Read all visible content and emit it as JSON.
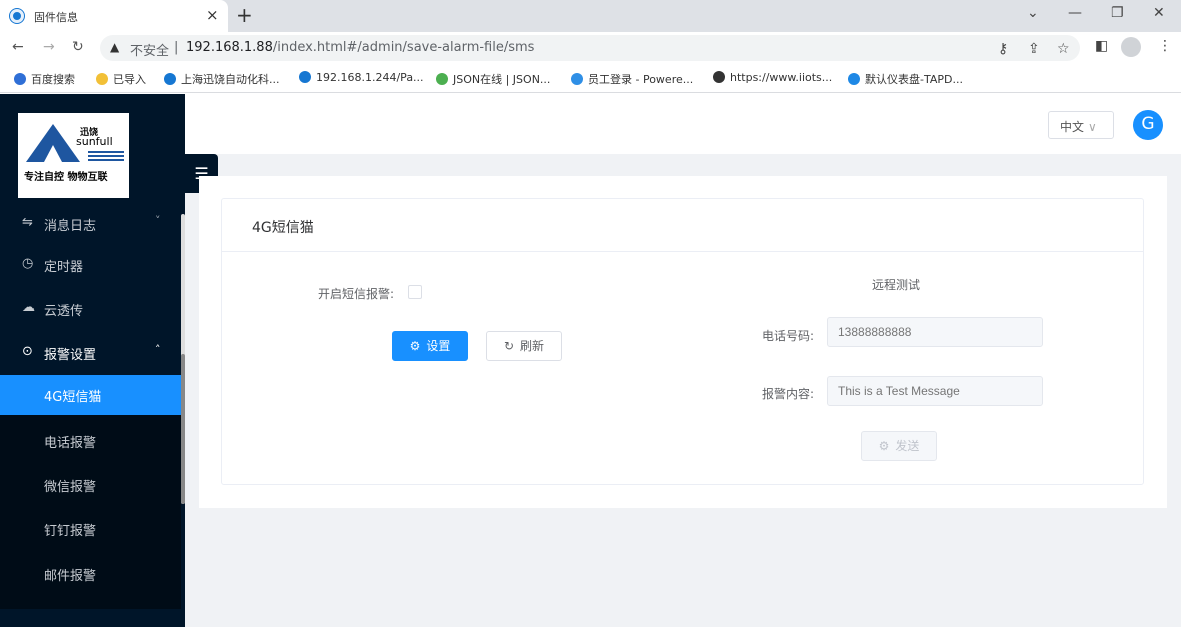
{
  "browser": {
    "tab_title": "固件信息",
    "tab_close": "×",
    "new_tab": "+",
    "security_label": "不安全",
    "url_host": "192.168.1.88",
    "url_path": "/index.html#/admin/save-alarm-file/sms",
    "window_controls": {
      "minimize": "—",
      "restore": "❐",
      "close": "✕",
      "dropdown": "⌄"
    },
    "bookmarks": [
      {
        "label": "百度搜索",
        "color": "#2f6fd6"
      },
      {
        "label": "已导入",
        "color": "#f2c037"
      },
      {
        "label": "上海迅饶自动化科...",
        "color": "#1677d2"
      },
      {
        "label": "192.168.1.244/Pa...",
        "color": "#1677d2"
      },
      {
        "label": "JSON在线 | JSON...",
        "color": "#4caf50"
      },
      {
        "label": "员工登录 - Powere...",
        "color": "#2f8fe6"
      },
      {
        "label": "https://www.iiots...",
        "color": "#333333"
      },
      {
        "label": "默认仪表盘-TAPD...",
        "color": "#1e88e5"
      }
    ]
  },
  "logo": {
    "cn_name": "迅饶",
    "en_name": "sunfull",
    "slogan": "专注自控 物物互联"
  },
  "sidebar": {
    "items": [
      {
        "icon": "⇋",
        "label": "消息日志",
        "arrow": "˅"
      },
      {
        "icon": "◷",
        "label": "定时器"
      },
      {
        "icon": "☁",
        "label": "云透传"
      },
      {
        "icon": "⊙",
        "label": "报警设置",
        "arrow": "˄"
      }
    ],
    "sub_items": [
      {
        "label": "4G短信猫",
        "active": true
      },
      {
        "label": "电话报警"
      },
      {
        "label": "微信报警"
      },
      {
        "label": "钉钉报警"
      },
      {
        "label": "邮件报警"
      }
    ],
    "collapse_icon": "☰"
  },
  "header": {
    "language": "中文",
    "language_chevron": "∨",
    "avatar_glyph": "G"
  },
  "card": {
    "title": "4G短信猫",
    "enable_label": "开启短信报警:",
    "settings_button": "设置",
    "refresh_button": "刷新",
    "remote_test_title": "远程测试",
    "phone_label": "电话号码:",
    "phone_placeholder": "13888888888",
    "content_label": "报警内容:",
    "content_placeholder": "This is a Test Message",
    "send_button": "发送"
  },
  "colors": {
    "accent": "#1890ff",
    "sidebar_bg": "#001529"
  }
}
